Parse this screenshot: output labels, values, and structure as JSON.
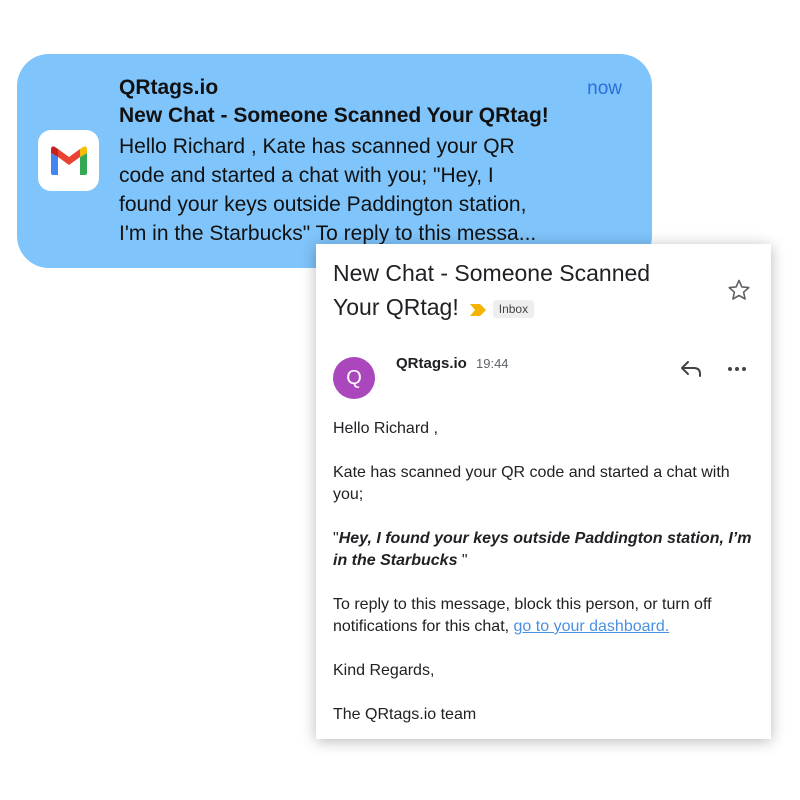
{
  "notification": {
    "sender": "QRtags.io",
    "time": "now",
    "subject": "New Chat - Someone Scanned Your QRtag!",
    "preview_lines": [
      "Hello Richard , Kate has scanned your QR",
      "code and started a chat with you; \"Hey, I",
      "found your keys outside Paddington station,",
      "I'm in the Starbucks\" To reply to this messa..."
    ],
    "app_icon": "gmail-icon"
  },
  "email": {
    "subject_lines": [
      "New Chat - Someone Scanned",
      "Your QRtag!"
    ],
    "label": "Inbox",
    "star_icon": "star-icon",
    "sender_initial": "Q",
    "sender_name": "QRtags.io",
    "time": "19:44",
    "avatar_color": "#ab47bc",
    "greeting": "Hello Richard ,",
    "intro": "Kate has scanned your QR code and started a chat with you;",
    "quote_open": "\"",
    "quote_text": "Hey, I found your keys outside Paddington station, I’m in the Starbucks ",
    "quote_close": "\"",
    "reply_text": "To reply to this message, block this person, or turn off notifications for this chat, ",
    "dashboard_link": "go to your dashboard.",
    "signoff": "Kind Regards,",
    "signature": "The QRtags.io team"
  },
  "colors": {
    "notification_bg": "#7fc4fb",
    "link": "#4a90e2",
    "importance_marker": "#f4b400"
  }
}
